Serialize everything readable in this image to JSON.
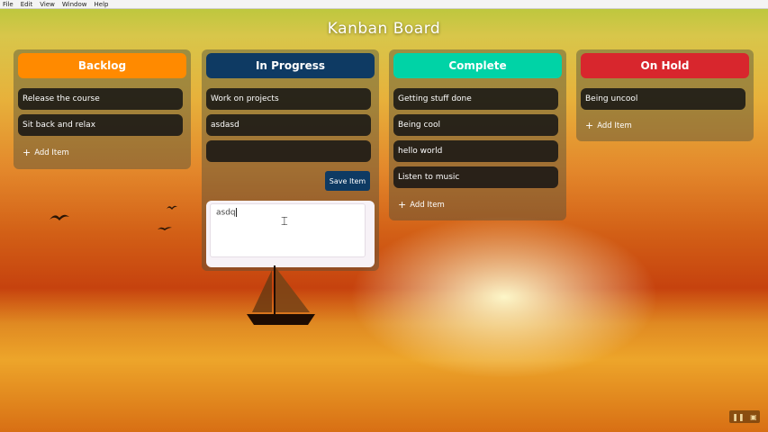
{
  "menu": [
    "File",
    "Edit",
    "View",
    "Window",
    "Help"
  ],
  "title": "Kanban Board",
  "columns": [
    {
      "title": "Backlog",
      "color": "#ff8a00",
      "cards": [
        "Release the course",
        "Sit back and relax"
      ],
      "add_label": "Add Item"
    },
    {
      "title": "In Progress",
      "color": "#0e3a63",
      "cards": [
        "Work on projects",
        "asdasd",
        ""
      ],
      "save_label": "Save Item",
      "input_value": "asdq"
    },
    {
      "title": "Complete",
      "color": "#00d3a6",
      "cards": [
        "Getting stuff done",
        "Being cool",
        "hello world",
        "Listen to music"
      ],
      "add_label": "Add Item"
    },
    {
      "title": "On Hold",
      "color": "#d8262d",
      "cards": [
        "Being uncool"
      ],
      "add_label": "Add Item"
    }
  ],
  "icons": {
    "add": "plus-icon",
    "cursor": "text-cursor-icon",
    "bird": "bird-icon",
    "boat": "sailboat-icon",
    "pause": "pause-icon",
    "image": "image-icon"
  }
}
